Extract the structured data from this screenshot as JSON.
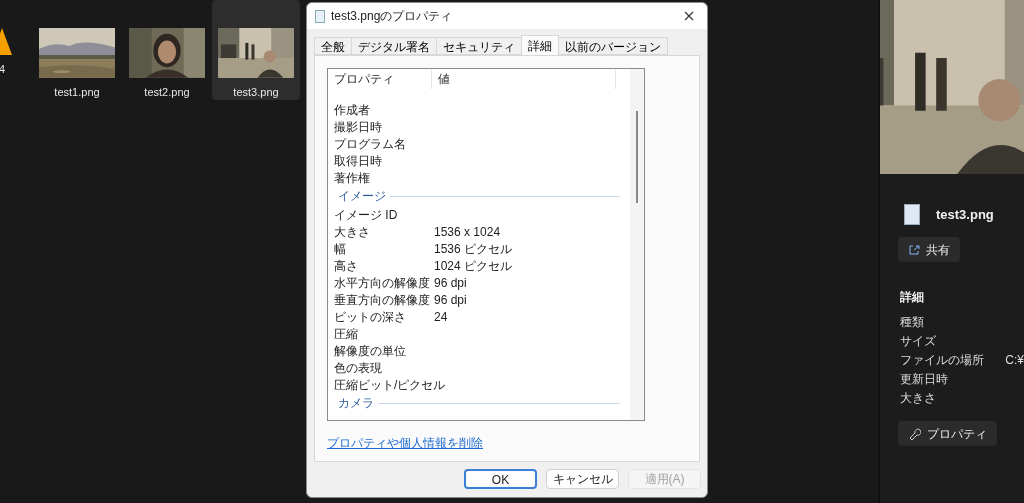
{
  "files": [
    {
      "kind": "icon",
      "name": "4",
      "selected": false
    },
    {
      "kind": "landscape",
      "name": "test1.png",
      "selected": false
    },
    {
      "kind": "portrait",
      "name": "test2.png",
      "selected": false
    },
    {
      "kind": "street",
      "name": "test3.png",
      "selected": true
    }
  ],
  "dialog": {
    "title": "test3.pngのプロパティ",
    "tabs": [
      {
        "label": "全般",
        "selected": false
      },
      {
        "label": "デジタル署名",
        "selected": false
      },
      {
        "label": "セキュリティ",
        "selected": false
      },
      {
        "label": "詳細",
        "selected": true
      },
      {
        "label": "以前のバージョン",
        "selected": false
      }
    ],
    "columns": [
      "プロパティ",
      "値"
    ],
    "rows": [
      {
        "kind": "property",
        "name": "作成者"
      },
      {
        "kind": "property",
        "name": "撮影日時"
      },
      {
        "kind": "property",
        "name": "プログラム名"
      },
      {
        "kind": "property",
        "name": "取得日時"
      },
      {
        "kind": "property",
        "name": "著作権"
      },
      {
        "kind": "group",
        "name": "イメージ"
      },
      {
        "kind": "property",
        "name": "イメージ ID"
      },
      {
        "kind": "property",
        "name": "大きさ",
        "value": "1536 x 1024"
      },
      {
        "kind": "property",
        "name": "幅",
        "value": "1536 ピクセル"
      },
      {
        "kind": "property",
        "name": "高さ",
        "value": "1024 ピクセル"
      },
      {
        "kind": "property",
        "name": "水平方向の解像度",
        "value": "96 dpi"
      },
      {
        "kind": "property",
        "name": "垂直方向の解像度",
        "value": "96 dpi"
      },
      {
        "kind": "property",
        "name": "ビットの深さ",
        "value": "24"
      },
      {
        "kind": "property",
        "name": "圧縮"
      },
      {
        "kind": "property",
        "name": "解像度の単位"
      },
      {
        "kind": "property",
        "name": "色の表現"
      },
      {
        "kind": "property",
        "name": "圧縮ビット/ピクセル"
      },
      {
        "kind": "group",
        "name": "カメラ"
      }
    ],
    "link": "プロパティや個人情報を削除",
    "buttons": [
      {
        "label": "OK",
        "default": true,
        "disabled": false
      },
      {
        "label": "キャンセル",
        "default": false,
        "disabled": false
      },
      {
        "label": "適用(A)",
        "default": false,
        "disabled": true
      }
    ]
  },
  "details_pane": {
    "file_name": "test3.png",
    "share_button": "共有",
    "section_title": "詳細",
    "rows": [
      {
        "label": "種類"
      },
      {
        "label": "サイズ"
      },
      {
        "label": "ファイルの場所",
        "value": "C:¥"
      },
      {
        "label": "更新日時"
      },
      {
        "label": "大きさ"
      }
    ],
    "properties_button": "プロパティ"
  }
}
